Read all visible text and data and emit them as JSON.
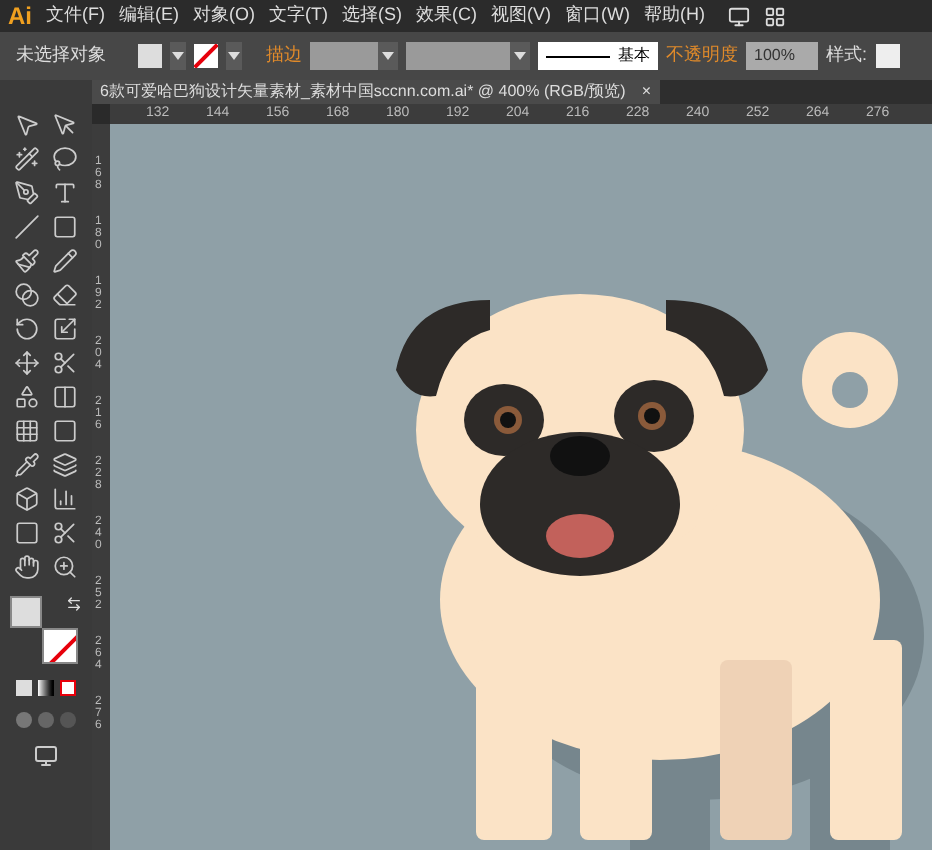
{
  "app": {
    "logo": "Ai"
  },
  "menu": [
    "文件(F)",
    "编辑(E)",
    "对象(O)",
    "文字(T)",
    "选择(S)",
    "效果(C)",
    "视图(V)",
    "窗口(W)",
    "帮助(H)"
  ],
  "control_bar": {
    "selection": "未选择对象",
    "stroke_label": "描边",
    "brush": "基本",
    "opacity_label": "不透明度",
    "opacity": "100%",
    "style_label": "样式:"
  },
  "document_tab": {
    "title": "6款可爱哈巴狗设计矢量素材_素材中国sccnn.com.ai* @ 400% (RGB/预览)",
    "close": "×"
  },
  "ruler_h": [
    "132",
    "144",
    "156",
    "168",
    "180",
    "192",
    "204",
    "216",
    "228",
    "240",
    "252",
    "264",
    "276"
  ],
  "ruler_v": [
    "168",
    "180",
    "192",
    "204",
    "216",
    "228",
    "240",
    "252",
    "264",
    "276"
  ]
}
